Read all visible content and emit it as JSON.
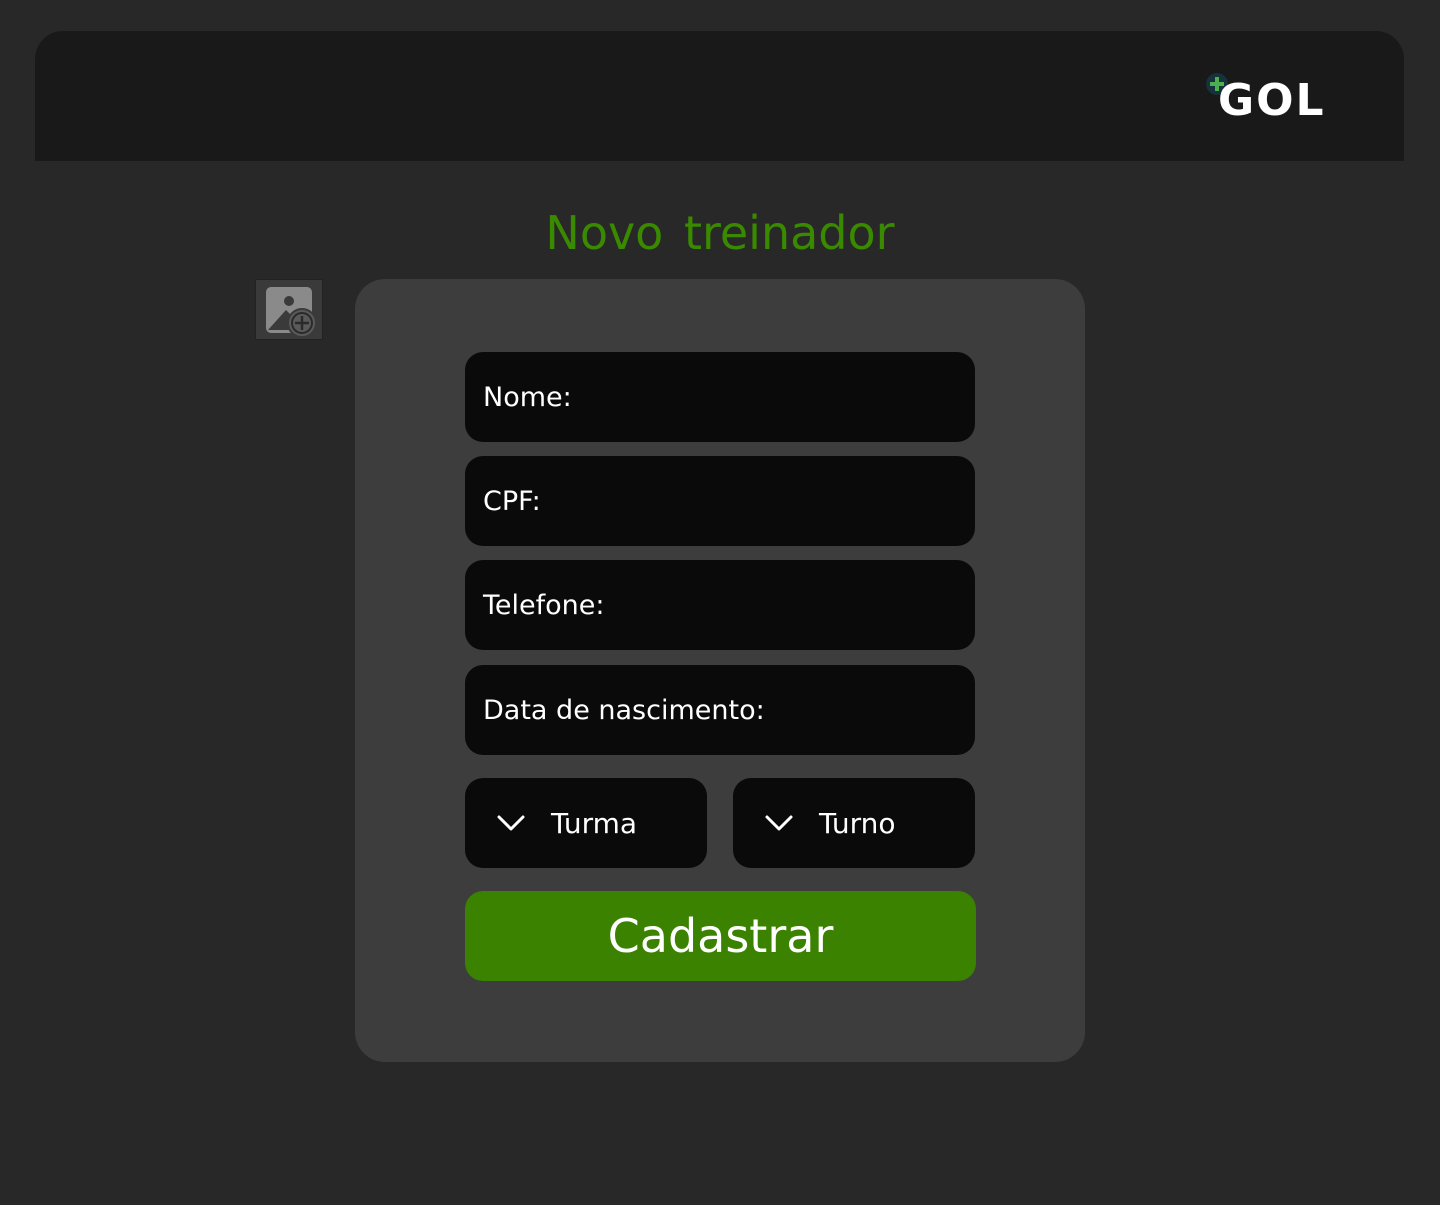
{
  "header": {
    "logo_text": "GOL",
    "logo_icon": "plus-icon"
  },
  "page": {
    "title": "Novo treinador",
    "photo_icon": "add-photo-icon"
  },
  "form": {
    "fields": [
      {
        "label": "Nome:",
        "value": ""
      },
      {
        "label": "CPF:",
        "value": ""
      },
      {
        "label": "Telefone:",
        "value": ""
      },
      {
        "label": "Data de nascimento:",
        "value": ""
      }
    ],
    "selects": [
      {
        "label": "Turma",
        "icon": "chevron-down-icon"
      },
      {
        "label": "Turno",
        "icon": "chevron-down-icon"
      }
    ],
    "submit_label": "Cadastrar"
  },
  "colors": {
    "background": "#282828",
    "header": "#191919",
    "card": "#3d3d3d",
    "input": "#0a0a0a",
    "accent": "#3a8200",
    "title": "#3a8a00"
  }
}
